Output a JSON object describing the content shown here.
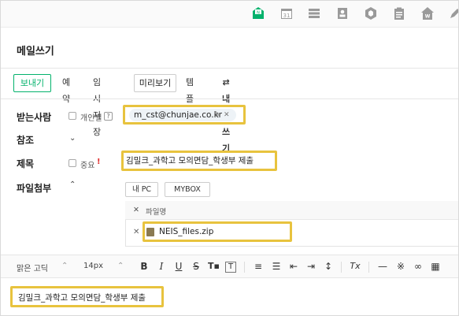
{
  "topbar": {
    "icons": [
      "mail-icon",
      "calendar-icon",
      "list-icon",
      "contacts-icon",
      "cube-icon",
      "clipboard-icon",
      "house-icon",
      "pen-icon"
    ],
    "calendar_day": "31",
    "colors": {
      "accent": "#03b26c"
    }
  },
  "title": "메일쓰기",
  "toolbar": {
    "send": "보내기",
    "reserve": "예약",
    "save_draft": "임시저장",
    "preview": "미리보기",
    "template": "템플릿",
    "to_me": "⇄ 내게쓰기"
  },
  "recipients": {
    "label": "받는사람",
    "individual_label": "개인별",
    "help": "?",
    "chip": "m_cst@chunjae.co.kr"
  },
  "cc": {
    "label": "참조"
  },
  "subject": {
    "label": "제목",
    "important_label": "중요",
    "important_mark": "!",
    "value": "김밀크_과학고 모의면담_학생부 제출"
  },
  "attach": {
    "label": "파일첨부",
    "my_pc": "내 PC",
    "mybox": "MYBOX",
    "column_filename": "파일명",
    "files": [
      {
        "name": "NEIS_files.zip"
      }
    ]
  },
  "editor": {
    "font": "맑은 고딕",
    "size": "14px",
    "body": "김밀크_과학고 모의면담_학생부 제출"
  }
}
